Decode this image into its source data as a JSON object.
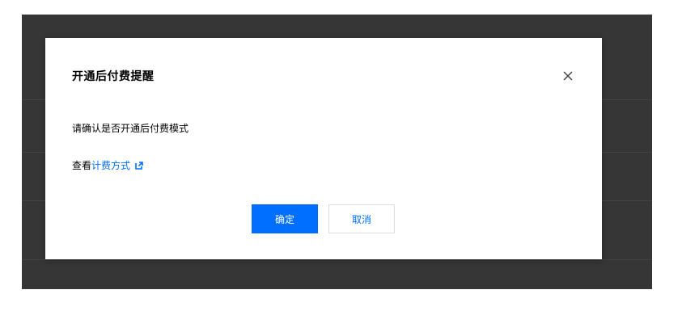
{
  "dialog": {
    "title": "开通后付费提醒",
    "message": "请确认是否开通后付费模式",
    "link_prefix": "查看",
    "link_text": "计费方式",
    "confirm_label": "确定",
    "cancel_label": "取消"
  },
  "icons": {
    "close": "close-icon",
    "external": "external-link-icon"
  },
  "colors": {
    "accent": "#006eff",
    "overlay": "#363636"
  }
}
